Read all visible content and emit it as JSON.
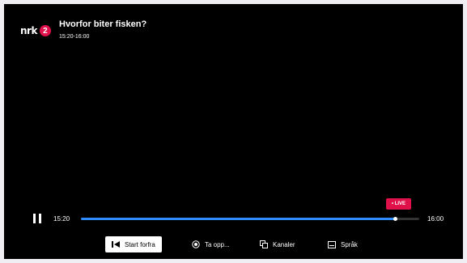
{
  "channel": {
    "logo_text": "nrk",
    "logo_badge": "2"
  },
  "program": {
    "title": "Hvorfor biter fisken?",
    "time_range": "15:20-16:00"
  },
  "player": {
    "live_label": "• LIVE",
    "start_time": "15:20",
    "end_time": "16:00",
    "progress": 0.93,
    "state": "playing",
    "accent_color": "#2f8bff",
    "live_color": "#e0114a"
  },
  "controls": [
    {
      "label": "Start forfra",
      "icon": "skip-back-icon"
    },
    {
      "label": "Ta opp...",
      "icon": "record-icon"
    },
    {
      "label": "Kanaler",
      "icon": "channels-icon"
    },
    {
      "label": "Språk",
      "icon": "subtitles-icon"
    }
  ]
}
